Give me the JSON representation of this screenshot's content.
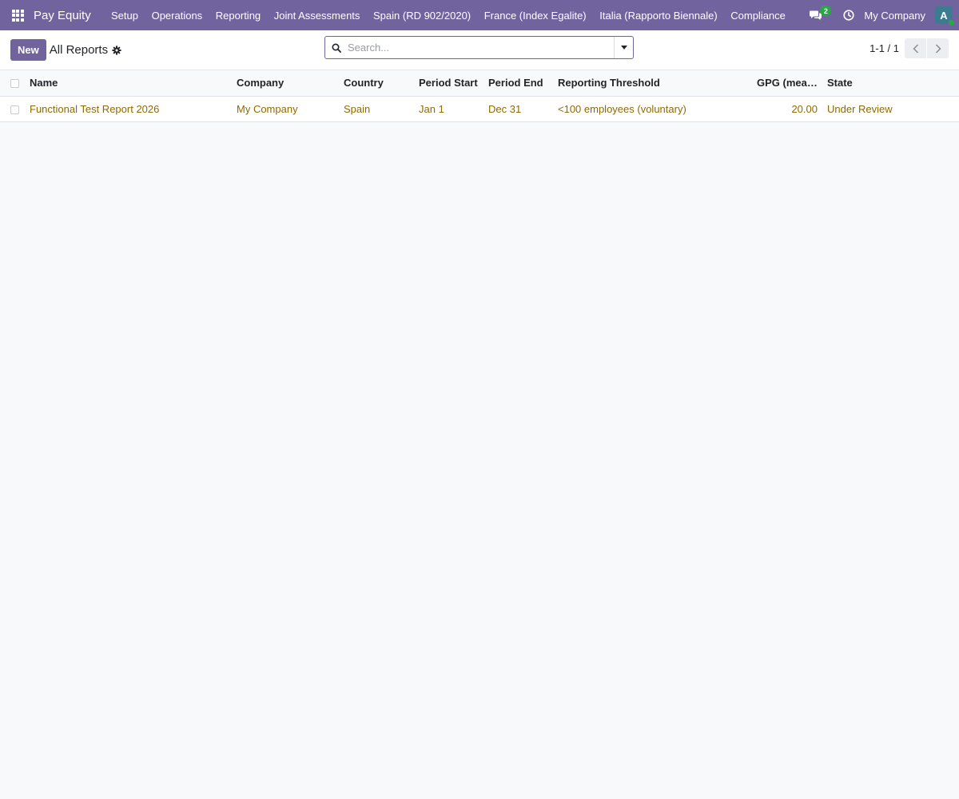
{
  "navbar": {
    "app_name": "Pay Equity",
    "menu": [
      "Setup",
      "Operations",
      "Reporting",
      "Joint Assessments",
      "Spain (RD 902/2020)",
      "France (Index Egalite)",
      "Italia (Rapporto Biennale)",
      "Compliance"
    ],
    "messages_count": "2",
    "company": "My Company",
    "avatar_initial": "A",
    "colors": {
      "bar": "#71639e",
      "badge": "#28a745",
      "avatar": "#3d7b91"
    }
  },
  "control_panel": {
    "new_label": "New",
    "breadcrumb": "All Reports",
    "search_placeholder": "Search...",
    "search_value": "",
    "pager": "1-1 / 1"
  },
  "list": {
    "columns": [
      "Name",
      "Company",
      "Country",
      "Period Start",
      "Period End",
      "Reporting Threshold",
      "GPG (mean)...",
      "State"
    ],
    "rows": [
      {
        "name": "Functional Test Report 2026",
        "company": "My Company",
        "country": "Spain",
        "period_start": "Jan 1",
        "period_end": "Dec 31",
        "reporting_threshold": "<100 employees (voluntary)",
        "gpg_mean": "20.00",
        "state": "Under Review"
      }
    ],
    "link_color": "#8f6a00"
  }
}
